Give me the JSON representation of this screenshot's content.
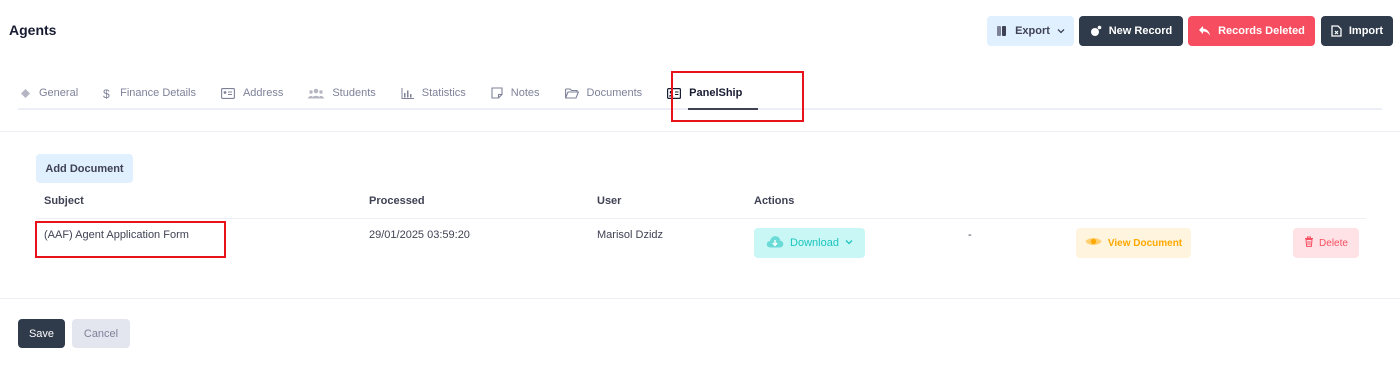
{
  "header": {
    "title": "Agents",
    "buttons": {
      "export": "Export",
      "new_record": "New Record",
      "records_deleted": "Records Deleted",
      "import": "Import"
    }
  },
  "tabs": [
    {
      "label": "General",
      "icon": "diamond-icon"
    },
    {
      "label": "Finance Details",
      "icon": "dollar-icon"
    },
    {
      "label": "Address",
      "icon": "address-card-icon"
    },
    {
      "label": "Students",
      "icon": "users-icon"
    },
    {
      "label": "Statistics",
      "icon": "bar-chart-icon"
    },
    {
      "label": "Notes",
      "icon": "note-icon"
    },
    {
      "label": "Documents",
      "icon": "folder-icon"
    },
    {
      "label": "PanelShip",
      "icon": "id-card-icon",
      "active": true
    }
  ],
  "documents": {
    "add_button": "Add Document",
    "columns": {
      "subject": "Subject",
      "processed": "Processed",
      "user": "User",
      "actions": "Actions"
    },
    "rows": [
      {
        "subject": "(AAF) Agent Application Form",
        "processed": "29/01/2025 03:59:20",
        "user": "Marisol Dzidz",
        "download_label": "Download",
        "dash": "-",
        "view_label": "View Document",
        "delete_label": "Delete"
      }
    ]
  },
  "footer": {
    "save": "Save",
    "cancel": "Cancel"
  },
  "colors": {
    "dark_button": "#2f3a4a",
    "danger": "#f64e60",
    "light_primary": "#e1f0ff",
    "success": "#1bc5bd",
    "warning": "#ffa800",
    "highlight_box": "#e8121a"
  }
}
